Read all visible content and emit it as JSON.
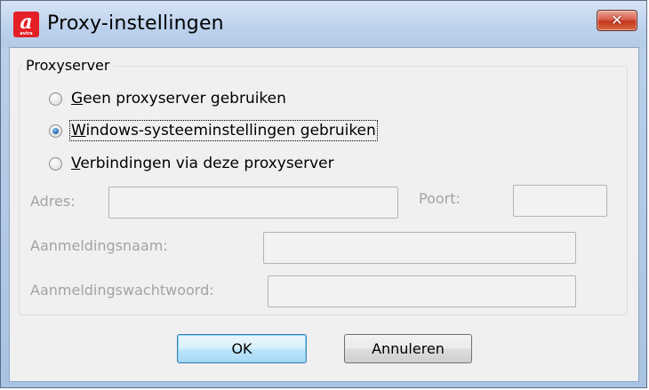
{
  "window": {
    "title": "Proxy-instellingen",
    "close_label": "✕",
    "app_icon_glyph": "a",
    "app_icon_subtext": "avira"
  },
  "proxy_group": {
    "legend": "Proxyserver",
    "options": [
      {
        "mnemonic": "G",
        "rest": "een proxyserver gebruiken",
        "checked": false
      },
      {
        "mnemonic": "W",
        "rest": "indows-systeeminstellingen gebruiken",
        "checked": true
      },
      {
        "mnemonic": "V",
        "rest": "erbindingen via deze proxyserver",
        "checked": false
      }
    ],
    "address_label": "Adres:",
    "address_value": "",
    "port_label": "Poort:",
    "port_value": "",
    "username_label": "Aanmeldingsnaam:",
    "username_value": "",
    "password_label": "Aanmeldingswachtwoord:",
    "password_value": ""
  },
  "buttons": {
    "ok_label": "OK",
    "cancel_label": "Annuleren"
  },
  "colors": {
    "accent": "#1c5fa8",
    "close_button": "#c4371f",
    "disabled_text": "#a3a3a3"
  },
  "icons": {
    "app": "avira-logo-icon",
    "close": "close-icon"
  }
}
